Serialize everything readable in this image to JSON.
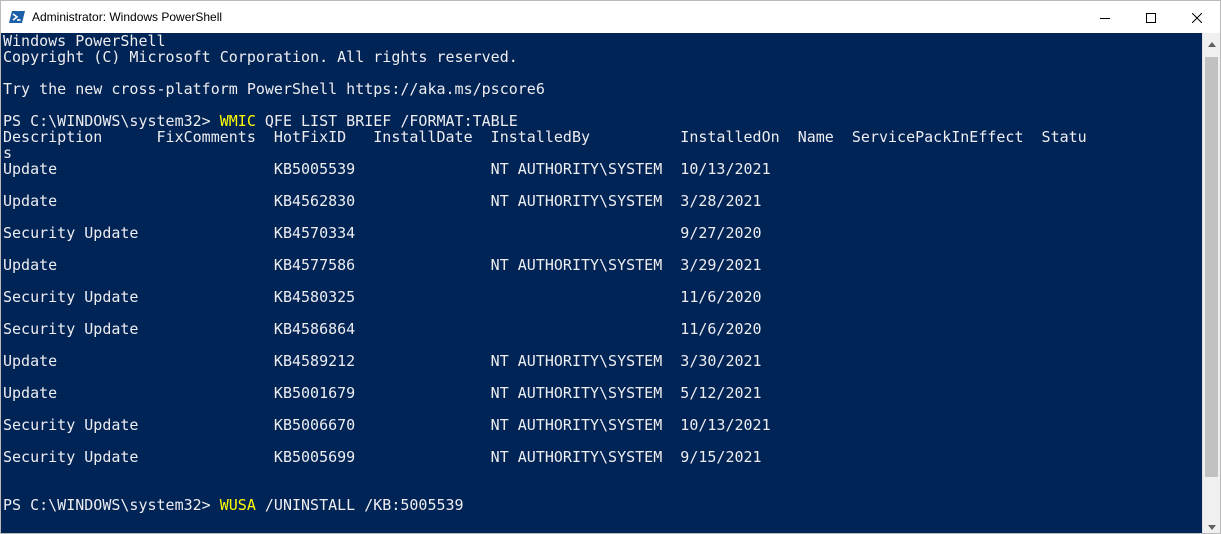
{
  "window": {
    "title": "Administrator: Windows PowerShell",
    "icons": {
      "app": "powershell-icon",
      "minimize": "minimize-icon",
      "maximize": "maximize-icon",
      "close": "close-icon"
    }
  },
  "console": {
    "colors": {
      "background": "#012456",
      "text": "#eeedf0",
      "command": "#ffff00"
    },
    "header": [
      "Windows PowerShell",
      "Copyright (C) Microsoft Corporation. All rights reserved.",
      "",
      "Try the new cross-platform PowerShell https://aka.ms/pscore6",
      ""
    ],
    "command1": {
      "prompt": "PS C:\\WINDOWS\\system32> ",
      "cmd": "WMIC",
      "args": " QFE LIST BRIEF /FORMAT:TABLE"
    },
    "table_header": "Description      FixComments  HotFixID   InstallDate  InstalledBy          InstalledOn  Name  ServicePackInEffect  Statu",
    "table_header_wrap": "s",
    "rows": [
      "Update                        KB5005539               NT AUTHORITY\\SYSTEM  10/13/2021",
      "",
      "Update                        KB4562830               NT AUTHORITY\\SYSTEM  3/28/2021",
      "",
      "Security Update               KB4570334                                    9/27/2020",
      "",
      "Update                        KB4577586               NT AUTHORITY\\SYSTEM  3/29/2021",
      "",
      "Security Update               KB4580325                                    11/6/2020",
      "",
      "Security Update               KB4586864                                    11/6/2020",
      "",
      "Update                        KB4589212               NT AUTHORITY\\SYSTEM  3/30/2021",
      "",
      "Update                        KB5001679               NT AUTHORITY\\SYSTEM  5/12/2021",
      "",
      "Security Update               KB5006670               NT AUTHORITY\\SYSTEM  10/13/2021",
      "",
      "Security Update               KB5005699               NT AUTHORITY\\SYSTEM  9/15/2021",
      "",
      ""
    ],
    "command2": {
      "prompt": "PS C:\\WINDOWS\\system32> ",
      "cmd": "WUSA",
      "args": " /UNINSTALL /KB:5005539"
    }
  }
}
